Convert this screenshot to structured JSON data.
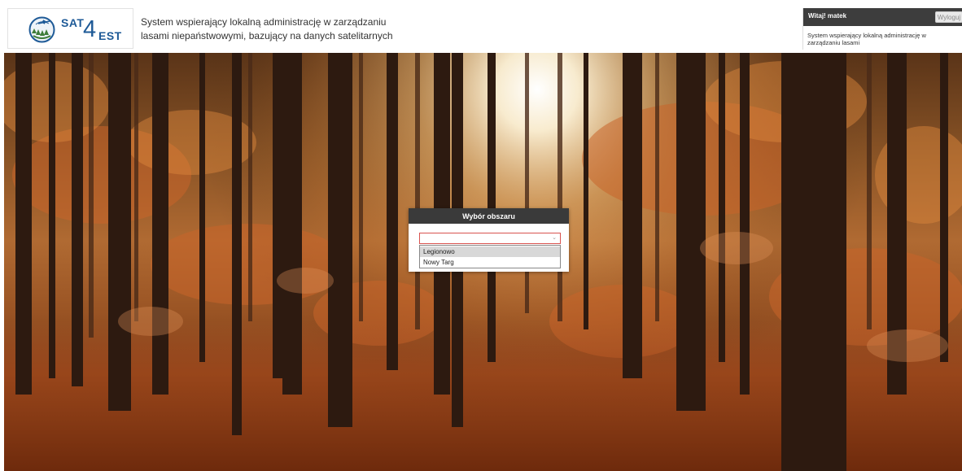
{
  "header": {
    "logo": {
      "sat": "SAT",
      "four": "4",
      "est": "EST"
    },
    "system_title": "System wspierający lokalną administrację w zarządzaniu lasami niepaństwowymi, bazujący na danych satelitarnych"
  },
  "user_panel": {
    "welcome": "Witaj! matek",
    "logout_label": "Wyloguj",
    "description": "System wspierający lokalną administrację w zarządzaniu lasami"
  },
  "area_modal": {
    "title": "Wybór obszaru",
    "selected_value": "",
    "options": [
      "Legionowo",
      "Nowy Targ"
    ],
    "highlighted_index": 0
  },
  "background": {
    "icon": "autumn-forest-photo"
  },
  "colors": {
    "brand_blue": "#1e5a97",
    "header_dark": "#3a3a3a",
    "select_border": "#d9534f"
  }
}
